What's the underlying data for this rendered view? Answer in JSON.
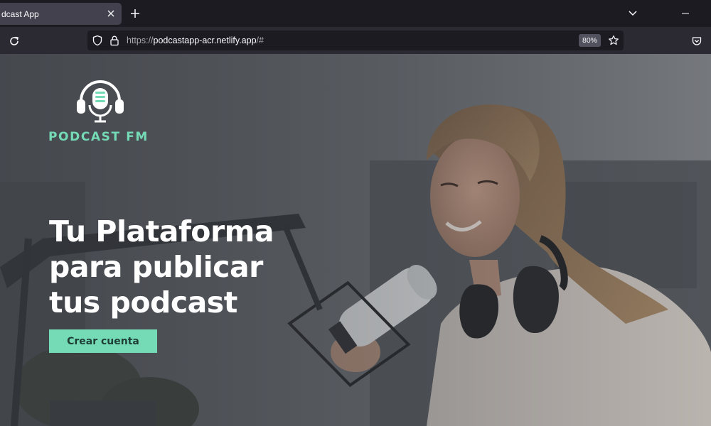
{
  "browser": {
    "tab_title": "dcast App",
    "url_prefix": "https://",
    "url_host": "podcastapp-acr.netlify.app",
    "url_suffix": "/#",
    "zoom": "80%"
  },
  "page": {
    "logo_text": "PODCAST FM",
    "hero_lines": [
      "Tu Plataforma",
      "para publicar",
      "tus podcast"
    ],
    "cta_label": "Crear cuenta"
  },
  "colors": {
    "accent": "#74dbb6",
    "chrome_dark": "#1c1b22",
    "chrome_tab": "#42414d",
    "chrome_toolbar": "#2b2a33"
  },
  "icons": {
    "tab_close": "close-icon",
    "new_tab": "plus-icon",
    "list_tabs": "chevron-down-icon",
    "minimize": "minimize-icon",
    "reload": "reload-icon",
    "tracking": "shield-icon",
    "security": "lock-icon",
    "bookmark": "star-icon",
    "pocket": "pocket-icon",
    "logo": "headphones-microphone-icon"
  }
}
